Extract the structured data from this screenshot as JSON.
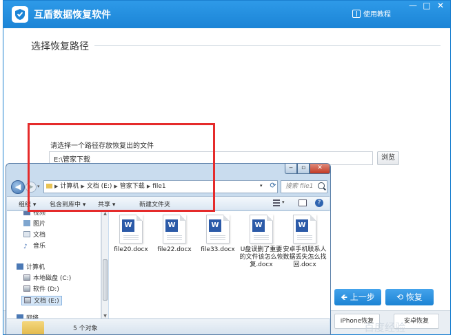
{
  "app": {
    "title": "互盾数据恢复软件",
    "help_label": "使用教程",
    "win_min": "—",
    "win_max": "□",
    "win_close": "✕"
  },
  "section": {
    "title": "选择恢复路径"
  },
  "path": {
    "label": "请选择一个路径存放恢复出的文件",
    "value": "E:\\管家下载",
    "browse_label": "浏览"
  },
  "actions": {
    "back_label": "上一步",
    "recover_label": "恢复",
    "iphone_label": "iPhone恢复",
    "android_label": "安卓恢复"
  },
  "watermark": "百度经验",
  "dialog": {
    "address": [
      "计算机",
      "文档 (E:)",
      "管家下载",
      "file1"
    ],
    "search_placeholder": "搜索 file1",
    "toolbar": {
      "organize": "组织 ▾",
      "include": "包含到库中 ▾",
      "share": "共享 ▾",
      "new_folder": "新建文件夹"
    },
    "nav": {
      "libraries": [
        {
          "label": "视频",
          "icon": "video-icon"
        },
        {
          "label": "图片",
          "icon": "picture-icon"
        },
        {
          "label": "文档",
          "icon": "document-icon"
        },
        {
          "label": "音乐",
          "icon": "music-icon"
        }
      ],
      "computer": "计算机",
      "drives": [
        "本地磁盘 (C:)",
        "软件 (D:)",
        "文档 (E:)"
      ],
      "network": "网络"
    },
    "files": [
      "file20.docx",
      "file22.docx",
      "file33.docx",
      "U盘误删了重要的文件该怎么恢复.docx",
      "安卓手机联系人数据丢失怎么找回.docx"
    ],
    "status": "5 个对象"
  }
}
